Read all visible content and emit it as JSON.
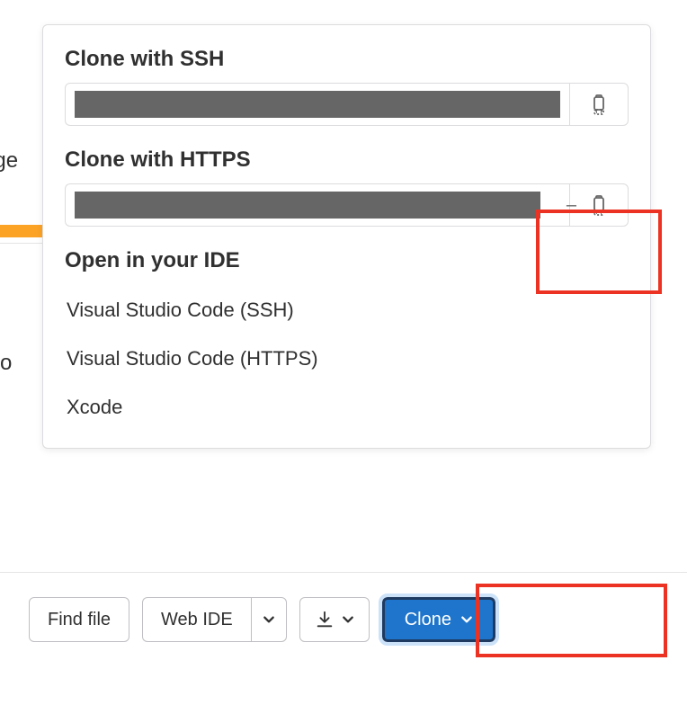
{
  "background": {
    "text1": "age",
    "text2": "d o"
  },
  "dropdown": {
    "ssh": {
      "title": "Clone with SSH"
    },
    "https": {
      "title": "Clone with HTTPS"
    },
    "ide": {
      "title": "Open in your IDE",
      "options": [
        "Visual Studio Code (SSH)",
        "Visual Studio Code (HTTPS)",
        "Xcode"
      ]
    }
  },
  "toolbar": {
    "find_file": "Find file",
    "web_ide": "Web IDE",
    "clone": "Clone"
  }
}
